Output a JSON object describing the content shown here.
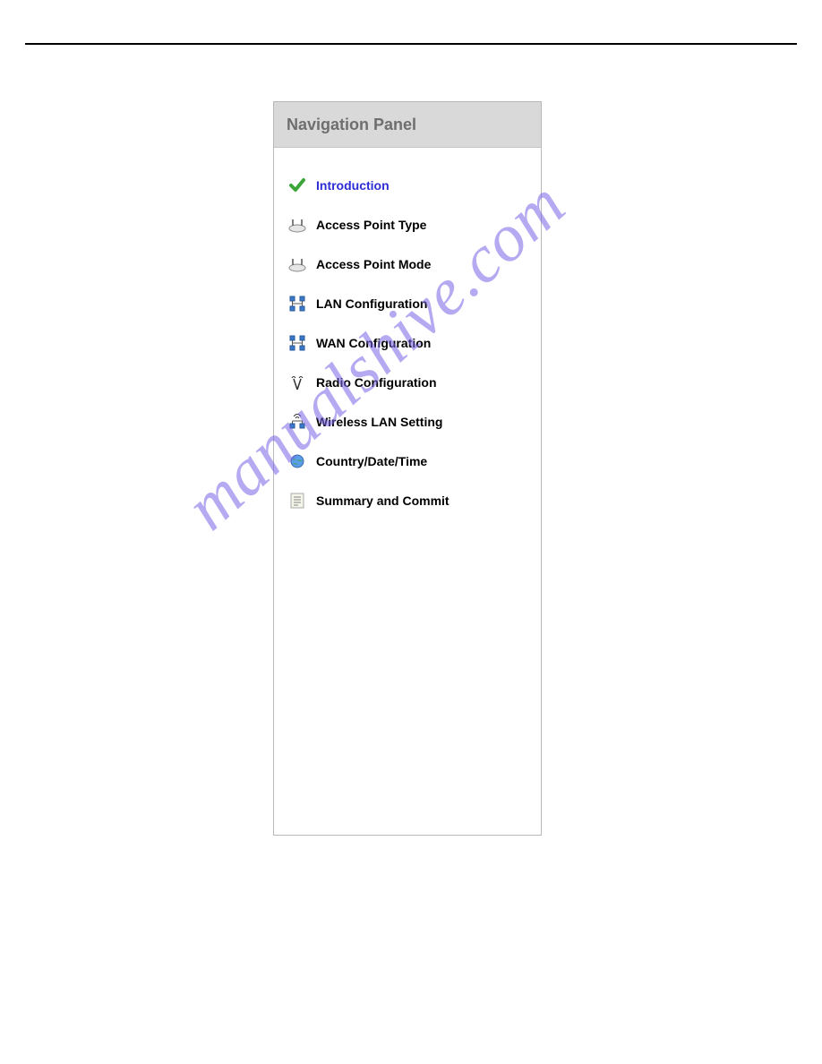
{
  "panel": {
    "title": "Navigation Panel",
    "items": [
      {
        "label": "Introduction",
        "active": true
      },
      {
        "label": "Access Point Type",
        "active": false
      },
      {
        "label": "Access Point Mode",
        "active": false
      },
      {
        "label": "LAN Configuration",
        "active": false
      },
      {
        "label": "WAN Configuration",
        "active": false
      },
      {
        "label": "Radio Configuration",
        "active": false
      },
      {
        "label": "Wireless LAN Setting",
        "active": false
      },
      {
        "label": "Country/Date/Time",
        "active": false
      },
      {
        "label": "Summary and Commit",
        "active": false
      }
    ]
  },
  "watermark": "manualshive.com"
}
